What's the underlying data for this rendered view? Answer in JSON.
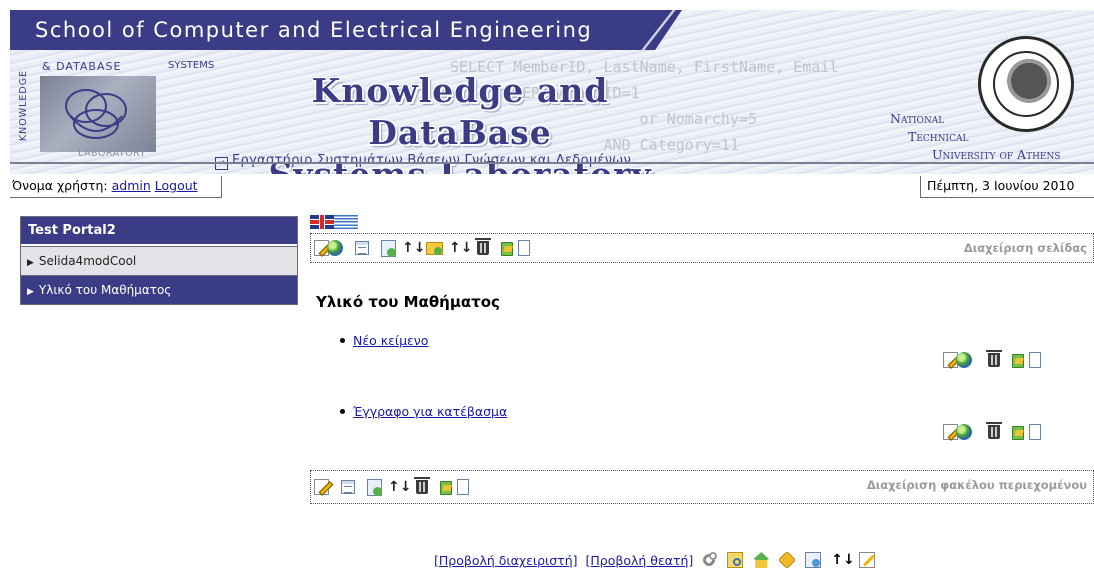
{
  "header": {
    "school_title": "School of Computer and Electrical Engineering",
    "lab_title_line1": "Knowledge and DataBase",
    "lab_title_line2": "Systems Laboratory",
    "lab_subtitle_greek": "Εργαστήριο Συστημάτων Βάσεων Γνώσεων και Δεδομένων",
    "kdbsl_logo": {
      "top": "& DATABASE",
      "left": "KNOWLEDGE",
      "right": "SYSTEMS",
      "bottom": "LABORATORY"
    },
    "sql_watermark": "SELECT MemberID, LastName, FirstName, Email\n      WHERE AnnexID=1\n                     or Nomarchy=5\n                 AND Category=11",
    "university": [
      "National",
      "Technical",
      "University of Athens"
    ]
  },
  "userbar": {
    "username_label": "Όνομα χρήστη:",
    "username": "admin",
    "logout": "Logout"
  },
  "date": "Πέμπτη, 3 Ιουνίου 2010",
  "sidebar": {
    "title": "Test Portal2",
    "items": [
      {
        "label": "Selida4modCool",
        "active": false
      },
      {
        "label": "Υλικό του Μαθήματος",
        "active": true
      }
    ]
  },
  "languages": [
    "English",
    "Ελληνικά"
  ],
  "page_toolbar": {
    "label": "Διαχείριση σελίδας",
    "icons": [
      "edit-icon",
      "globe-icon",
      "properties-icon",
      "new-page-icon",
      "move-up-down-icon",
      "new-folder-icon",
      "move-up-down-icon",
      "delete-icon",
      "copy-icon",
      "page-icon"
    ]
  },
  "content": {
    "title": "Υλικό του Μαθήματος",
    "items": [
      {
        "label": "Νέο κείμενο"
      },
      {
        "label": "Έγγραφο για κατέβασμα"
      }
    ],
    "item_icons": [
      "edit-icon",
      "globe-icon",
      "delete-icon",
      "copy-icon",
      "page-icon"
    ]
  },
  "folder_toolbar": {
    "label": "Διαχείριση φακέλου περιεχομένου",
    "icons": [
      "edit-icon",
      "properties-icon",
      "new-item-icon",
      "move-up-down-icon",
      "delete-icon",
      "copy-icon",
      "page-icon"
    ]
  },
  "footer": {
    "admin_view": "[Προβολή διαχειριστή]",
    "viewer_view": "[Προβολή θεατή]",
    "updown_glyph": "↑↓",
    "icons": [
      "settings-icon",
      "map-icon",
      "home-icon",
      "package-icon",
      "list-icon",
      "move-up-down-icon",
      "edit-icon"
    ]
  },
  "colors": {
    "brand": "#3a3d86",
    "link": "#1a1aa8",
    "sidebar_inactive": "#e4e4e8",
    "toolbar_label": "#9b9b9b"
  }
}
